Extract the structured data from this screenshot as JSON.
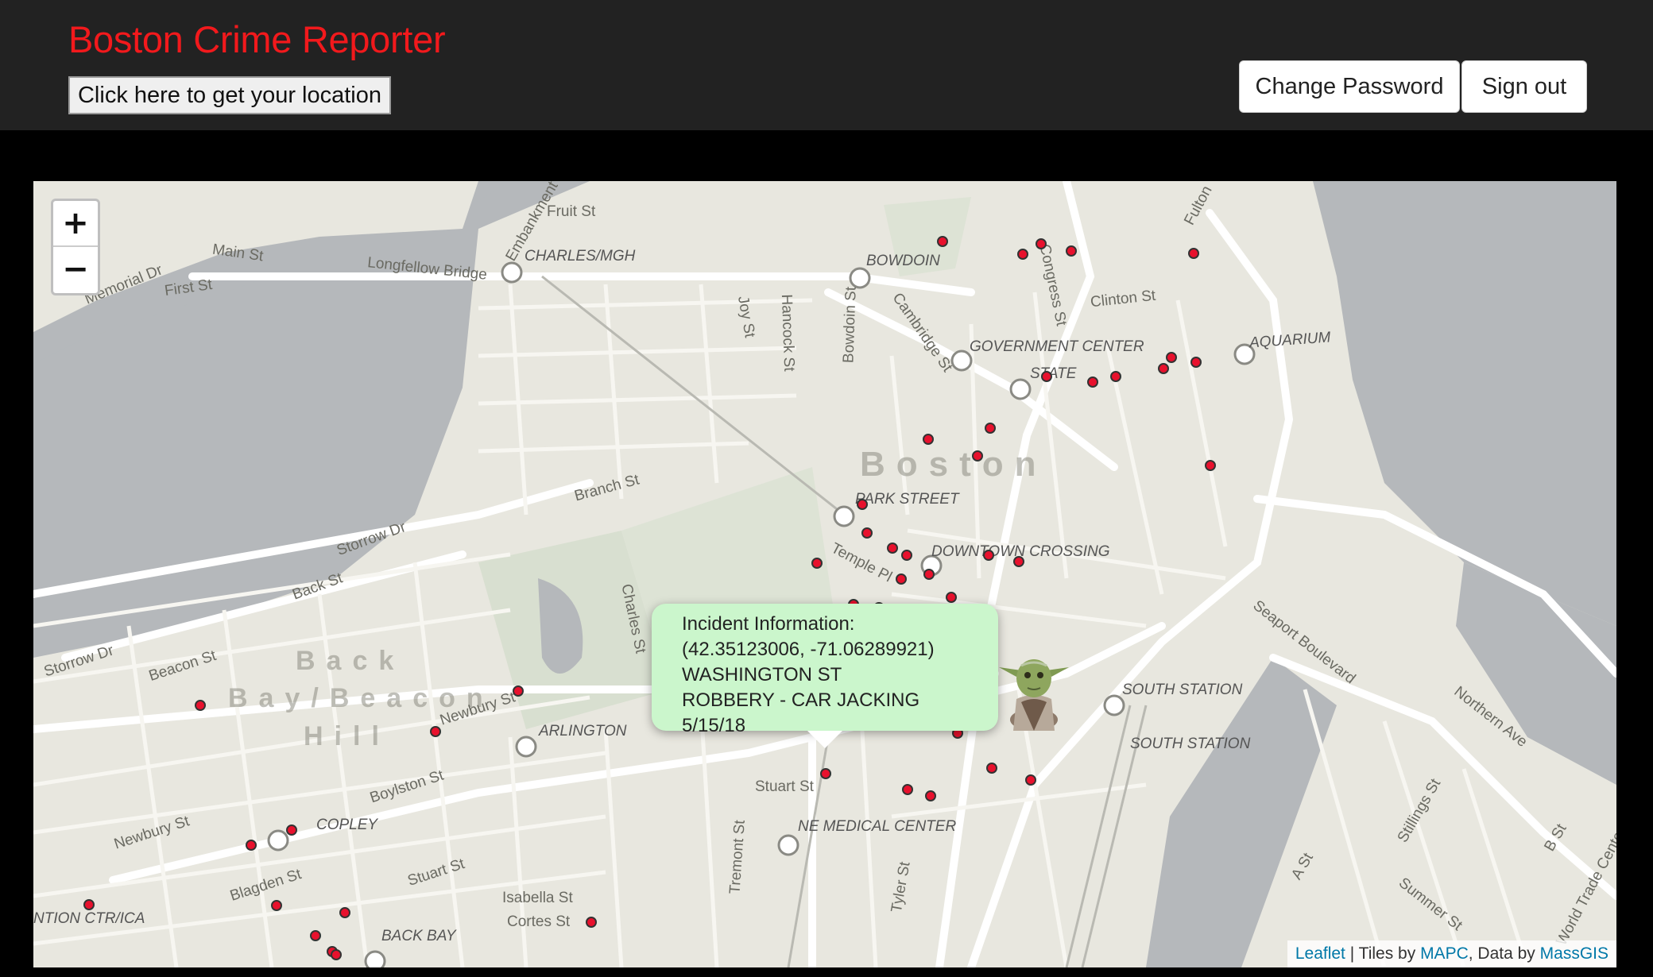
{
  "app": {
    "title": "Boston Crime Reporter",
    "locate_label": "Click here to get your location",
    "change_password_label": "Change Password",
    "sign_out_label": "Sign out"
  },
  "map": {
    "zoom_in": "+",
    "zoom_out": "−",
    "popup": {
      "heading": "Incident Information:",
      "coords": "(42.35123006, -71.06289921)",
      "street": "WASHINGTON ST",
      "offense": "ROBBERY - CAR JACKING",
      "date": "5/15/18"
    },
    "attribution": {
      "leaflet": "Leaflet",
      "sep1": " | Tiles by ",
      "mapc": "MAPC",
      "sep2": ", Data by ",
      "massgis": "MassGIS"
    },
    "marker_icon": "yoda-avatar-icon",
    "incident_marker_color": "#e8112d",
    "water_color": "#b5b8bb",
    "park_color": "#d8dfd0",
    "labels": {
      "boston": "Boston",
      "back_bay": "Back",
      "bay_beacon": "Bay/Beacon",
      "hill": "Hill",
      "fruit_st": "Fruit St",
      "main_st": "Main St",
      "memorial_dr": "Memorial Dr",
      "first_st": "First St",
      "longfellow": "Longfellow Bridge",
      "charles_mgh": "CHARLES/MGH",
      "bowdoin": "BOWDOIN",
      "joy_st": "Joy St",
      "hancock_st": "Hancock St",
      "bowdoin_st": "Bowdoin St",
      "cambridge_st": "Cambridge St",
      "congress_st": "Congress St",
      "clinton_st": "Clinton St",
      "government_center": "GOVERNMENT CENTER",
      "state": "STATE",
      "aquarium": "AQUARIUM",
      "branch_st": "Branch St",
      "park_street": "PARK STREET",
      "downtown_crossing": "DOWNTOWN CROSSING",
      "temple_pl": "Temple Pl",
      "storrow_dr": "Storrow Dr",
      "back_st": "Back St",
      "storrow_dr2": "Storrow Dr",
      "beacon_st": "Beacon St",
      "charles_st": "Charles St",
      "newbury_st": "Newbury St",
      "arlington": "ARLINGTON",
      "boylston_st": "Boylston St",
      "copley": "COPLEY",
      "newbury_st2": "Newbury St",
      "stuart_st": "Stuart St",
      "stuart_st2": "Stuart St",
      "blagden_st": "Blagden St",
      "ne_medical": "NE MEDICAL CENTER",
      "tremont_st": "Tremont St",
      "tyler_st": "Tyler St",
      "isabella_st": "Isabella St",
      "cortes_st": "Cortes St",
      "back_bay_station": "BACK BAY",
      "convention": "NTION CTR/ICA",
      "south_station": "SOUTH STATION",
      "south_station2": "SOUTH STATION",
      "seaport": "Seaport Boulevard",
      "northern_ave": "Northern Ave",
      "stillings_st": "Stillings St",
      "a_st": "A St",
      "b_st": "B St",
      "summer_st": "Summer St",
      "world_trade": "World Trade Cente",
      "fulton": "Fulton",
      "embankment": "Embankment"
    }
  }
}
